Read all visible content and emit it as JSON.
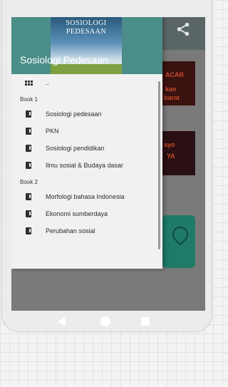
{
  "header": {
    "title": "Sosiologi Pedesaan",
    "cover_line1": "SOSIOLOGI",
    "cover_line2": "PEDESAAN"
  },
  "menu": {
    "top_item": "..",
    "sections": [
      {
        "label": "Book 1",
        "items": [
          "Sosiologi pedesaan",
          "PKN",
          "Sosiologi pendidikan",
          "Ilmu sosial & Budaya dasar"
        ]
      },
      {
        "label": "Book 2",
        "items": [
          "Morfologi bahasa Indonesia",
          "Ekonomi sumberdaya",
          "Perubahan sosial"
        ]
      }
    ]
  },
  "background": {
    "tile1": "kan",
    "tile2": "barat",
    "tile3": "ayo"
  },
  "colors": {
    "header": "#4a8d89",
    "appbar": "#5a6666",
    "drawer": "#f1f1f1"
  }
}
